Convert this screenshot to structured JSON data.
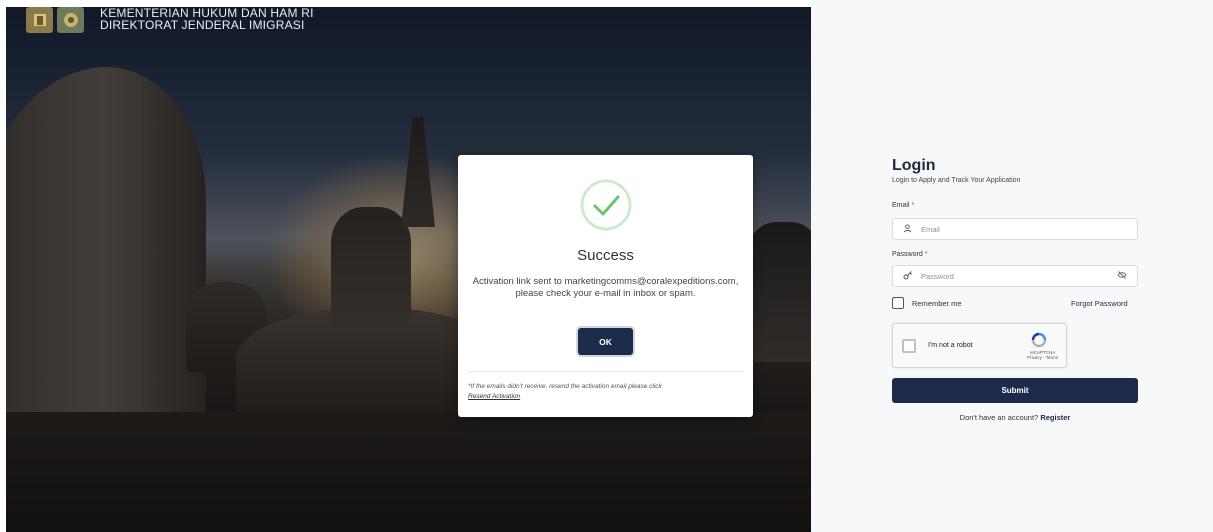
{
  "brand": {
    "line1": "KEMENTERIAN HUKUM DAN HAM RI",
    "line2": "DIREKTORAT JENDERAL IMIGRASI"
  },
  "login": {
    "title": "Login",
    "subtitle": "Login to Apply and Track Your Application",
    "email_label": "Email",
    "email_placeholder": "Email",
    "password_label": "Password",
    "password_placeholder": "Password",
    "required_mark": "*",
    "remember_label": "Remember me",
    "forgot_label": "Forgot Password",
    "captcha_label": "I'm not a robot",
    "captcha_brand": "reCAPTCHA",
    "captcha_links": "Privacy - Terms",
    "submit_label": "Submit",
    "no_account_text": "Don't have an account?",
    "register_label": "Register"
  },
  "modal": {
    "title": "Success",
    "message": "Activation link sent to marketingcomms@coralexpeditions.com, please check your e-mail in inbox or spam.",
    "ok_label": "OK",
    "note": "*If the emails didn't receive, resend the activation email please click",
    "resend_label": "Resend Activation"
  },
  "colors": {
    "primary": "#1d2b4a",
    "success": "#6cc46c",
    "required": "#d93a3a"
  }
}
